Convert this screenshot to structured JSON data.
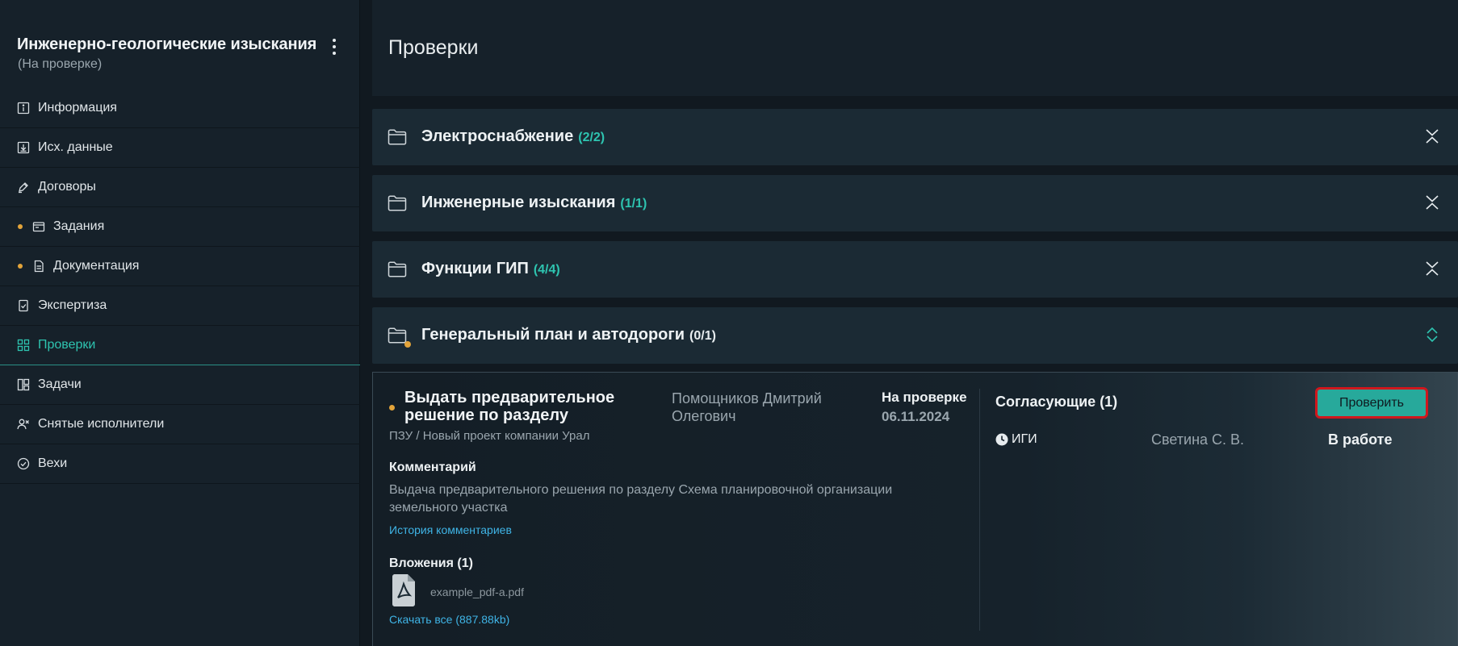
{
  "sidebar": {
    "title": "Инженерно-геологические изыскания",
    "subtitle": "(На проверке)",
    "items": [
      {
        "label": "Информация",
        "icon": "info-icon"
      },
      {
        "label": "Исх. данные",
        "icon": "download-box-icon"
      },
      {
        "label": "Договоры",
        "icon": "pen-icon"
      },
      {
        "label": "Задания",
        "icon": "folder-card-icon"
      },
      {
        "label": "Документация",
        "icon": "document-icon"
      },
      {
        "label": "Экспертиза",
        "icon": "checklist-icon"
      },
      {
        "label": "Проверки",
        "icon": "grid-icon"
      },
      {
        "label": "Задачи",
        "icon": "board-icon"
      },
      {
        "label": "Снятые исполнители",
        "icon": "user-remove-icon"
      },
      {
        "label": "Вехи",
        "icon": "check-circle-icon"
      }
    ]
  },
  "page": {
    "title": "Проверки"
  },
  "folders": [
    {
      "name": "Электроснабжение",
      "count": "(2/2)"
    },
    {
      "name": "Инженерные изыскания",
      "count": "(1/1)"
    },
    {
      "name": "Функции ГИП",
      "count": "(4/4)"
    },
    {
      "name": "Генеральный план и автодороги",
      "count": "(0/1)"
    }
  ],
  "task": {
    "title": "Выдать предварительное решение по разделу",
    "path": "ПЗУ / Новый проект компании Урал",
    "person": "Помощников Дмитрий Олегович",
    "status": "На проверке",
    "date": "06.11.2024",
    "comment_heading": "Комментарий",
    "comment_text": "Выдача предварительного решения по разделу Схема планировочной организации земельного участка",
    "history_link": "История комментариев",
    "attachments_heading": "Вложения (1)",
    "attachment_name": "example_pdf-a.pdf",
    "download_all": "Скачать все (887.88kb)"
  },
  "approvers": {
    "heading": "Согласующие (1)",
    "check_button": "Проверить",
    "rows": [
      {
        "role": "ИГИ",
        "person": "Светина С. В.",
        "status": "В работе"
      }
    ]
  },
  "colors": {
    "accent": "#2ec4b0",
    "warning_dot": "#e3a43a",
    "link": "#3fb4e6",
    "highlight": "#d0171d"
  }
}
